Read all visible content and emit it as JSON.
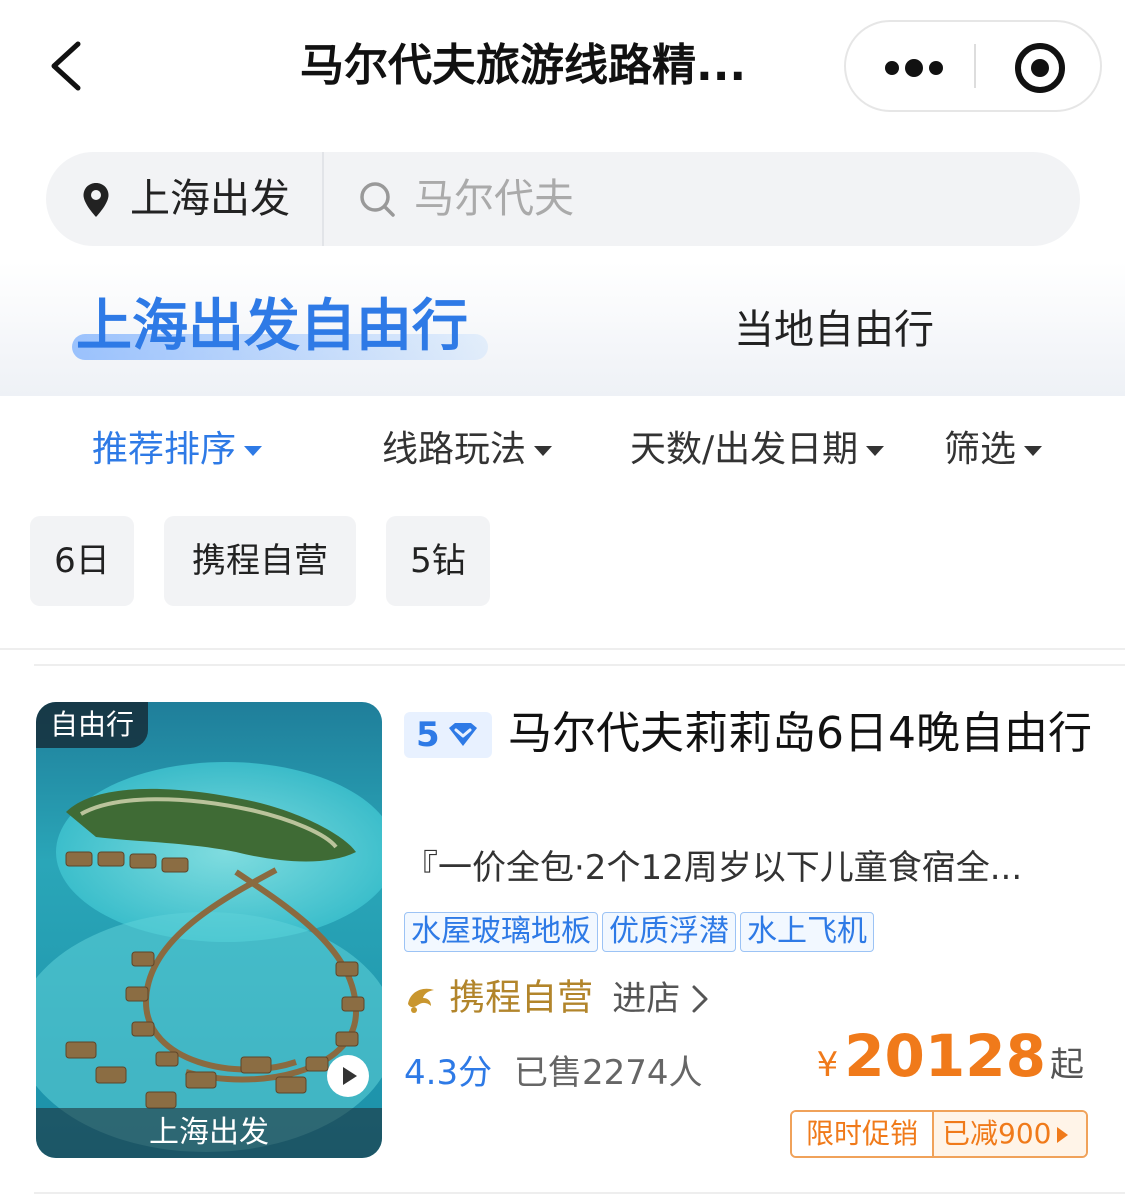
{
  "header": {
    "title": "马尔代夫旅游线路精..."
  },
  "search": {
    "city": "上海出发",
    "placeholder": "马尔代夫"
  },
  "tabs": {
    "active": "上海出发自由行",
    "inactive": "当地自由行"
  },
  "filters": [
    {
      "label": "推荐排序",
      "active": true
    },
    {
      "label": "线路玩法",
      "active": false
    },
    {
      "label": "天数/出发日期",
      "active": false
    },
    {
      "label": "筛选",
      "active": false
    }
  ],
  "chips": [
    "6日",
    "携程自营",
    "5钻"
  ],
  "product": {
    "thumb_tag": "自由行",
    "thumb_caption": "上海出发",
    "grade": "5",
    "title": "马尔代夫莉莉岛6日4晚自由行",
    "description": "『一价全包·2个12周岁以下儿童食宿全...",
    "features": [
      "水屋玻璃地板",
      "优质浮潜",
      "水上飞机"
    ],
    "store_name": "携程自营",
    "store_enter": "进店",
    "rating": "4.3分",
    "sold": "已售2274人",
    "price_currency": "¥",
    "price_value": "20128",
    "price_suffix": "起",
    "promo_label": "限时促销",
    "promo_discount": "已减900"
  },
  "colors": {
    "accent": "#2e7ae6",
    "price": "#f07a1a",
    "store_gold": "#b2852b"
  }
}
